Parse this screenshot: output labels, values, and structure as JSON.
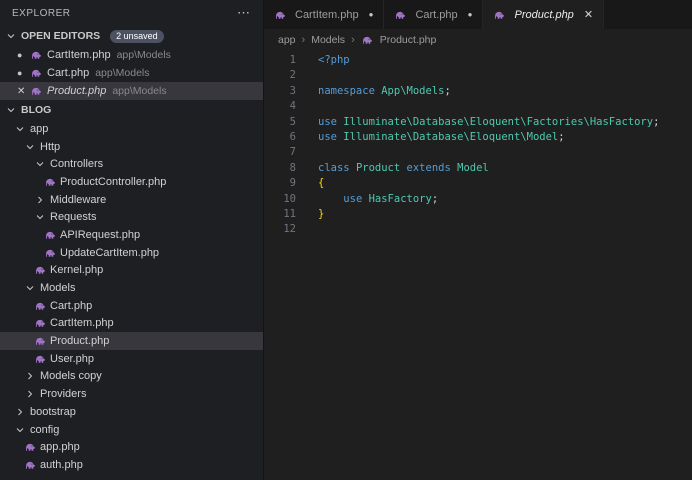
{
  "colors": {
    "keyword": "#569cd6",
    "type": "#4ec9b0",
    "text": "#d4d4d4",
    "brace": "#ffd700",
    "php_icon": "#a074c4",
    "selection": "#37373d",
    "badge_bg": "#4d5263"
  },
  "explorer": {
    "title": "EXPLORER",
    "open_editors": {
      "label": "OPEN EDITORS",
      "badge": "2 unsaved",
      "items": [
        {
          "label": "CartItem.php",
          "desc": "app\\Models",
          "state": "dot",
          "selected": false,
          "italic": false
        },
        {
          "label": "Cart.php",
          "desc": "app\\Models",
          "state": "dot",
          "selected": false,
          "italic": false
        },
        {
          "label": "Product.php",
          "desc": "app\\Models",
          "state": "close",
          "selected": true,
          "italic": true
        }
      ]
    },
    "project": {
      "label": "BLOG",
      "items": [
        {
          "label": "app",
          "kind": "folder-open",
          "indent": 0
        },
        {
          "label": "Http",
          "kind": "folder-open",
          "indent": 1
        },
        {
          "label": "Controllers",
          "kind": "folder-open",
          "indent": 2
        },
        {
          "label": "ProductController.php",
          "kind": "file",
          "indent": 3
        },
        {
          "label": "Middleware",
          "kind": "folder-closed",
          "indent": 2
        },
        {
          "label": "Requests",
          "kind": "folder-open",
          "indent": 2
        },
        {
          "label": "APIRequest.php",
          "kind": "file",
          "indent": 3
        },
        {
          "label": "UpdateCartItem.php",
          "kind": "file",
          "indent": 3
        },
        {
          "label": "Kernel.php",
          "kind": "file",
          "indent": 2
        },
        {
          "label": "Models",
          "kind": "folder-open",
          "indent": 1
        },
        {
          "label": "Cart.php",
          "kind": "file",
          "indent": 2
        },
        {
          "label": "CartItem.php",
          "kind": "file",
          "indent": 2
        },
        {
          "label": "Product.php",
          "kind": "file",
          "indent": 2,
          "selected": true
        },
        {
          "label": "User.php",
          "kind": "file",
          "indent": 2
        },
        {
          "label": "Models copy",
          "kind": "folder-closed",
          "indent": 1
        },
        {
          "label": "Providers",
          "kind": "folder-closed",
          "indent": 1
        },
        {
          "label": "bootstrap",
          "kind": "folder-closed",
          "indent": 0
        },
        {
          "label": "config",
          "kind": "folder-open",
          "indent": 0
        },
        {
          "label": "app.php",
          "kind": "file",
          "indent": 1
        },
        {
          "label": "auth.php",
          "kind": "file",
          "indent": 1
        }
      ]
    }
  },
  "tabs": [
    {
      "label": "CartItem.php",
      "state": "dot",
      "active": false,
      "italic": false
    },
    {
      "label": "Cart.php",
      "state": "dot",
      "active": false,
      "italic": false
    },
    {
      "label": "Product.php",
      "state": "close",
      "active": true,
      "italic": true
    }
  ],
  "breadcrumb": [
    "app",
    "Models",
    "Product.php"
  ],
  "editor": {
    "lines": [
      [
        {
          "t": "<?php",
          "c": "kw"
        }
      ],
      [],
      [
        {
          "t": "namespace",
          "c": "kw"
        },
        {
          "t": " ",
          "c": "plain"
        },
        {
          "t": "App\\Models",
          "c": "type"
        },
        {
          "t": ";",
          "c": "plain"
        }
      ],
      [],
      [
        {
          "t": "use",
          "c": "kw"
        },
        {
          "t": " ",
          "c": "plain"
        },
        {
          "t": "Illuminate\\Database\\Eloquent\\Factories\\HasFactory",
          "c": "type"
        },
        {
          "t": ";",
          "c": "plain"
        }
      ],
      [
        {
          "t": "use",
          "c": "kw"
        },
        {
          "t": " ",
          "c": "plain"
        },
        {
          "t": "Illuminate\\Database\\Eloquent\\Model",
          "c": "type"
        },
        {
          "t": ";",
          "c": "plain"
        }
      ],
      [],
      [
        {
          "t": "class",
          "c": "kw"
        },
        {
          "t": " ",
          "c": "plain"
        },
        {
          "t": "Product",
          "c": "type"
        },
        {
          "t": " ",
          "c": "plain"
        },
        {
          "t": "extends",
          "c": "kw"
        },
        {
          "t": " ",
          "c": "plain"
        },
        {
          "t": "Model",
          "c": "type"
        }
      ],
      [
        {
          "t": "{",
          "c": "brace"
        }
      ],
      [
        {
          "t": "    ",
          "c": "plain"
        },
        {
          "t": "use",
          "c": "kw"
        },
        {
          "t": " ",
          "c": "plain"
        },
        {
          "t": "HasFactory",
          "c": "type"
        },
        {
          "t": ";",
          "c": "plain"
        }
      ],
      [
        {
          "t": "}",
          "c": "brace"
        }
      ],
      []
    ]
  }
}
